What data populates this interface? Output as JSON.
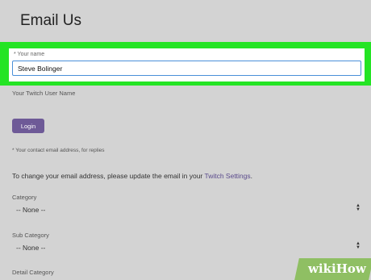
{
  "page": {
    "title": "Email Us"
  },
  "form": {
    "name_label": "* Your name",
    "name_value": "Steve Bolinger",
    "twitch_label": "Your Twitch User Name",
    "login_label": "Login",
    "contact_note": "* Your contact email address, for replies",
    "change_note_prefix": "To change your email address, please update the email in your ",
    "change_note_link": "Twitch Settings",
    "change_note_suffix": ".",
    "category_label": "Category",
    "category_value": "-- None --",
    "subcategory_label": "Sub Category",
    "subcategory_value": "-- None --",
    "detail_label": "Detail Category"
  },
  "watermark": {
    "text": "wikiHow"
  },
  "colors": {
    "highlight": "#24e424",
    "login_button": "#6e5a97",
    "link": "#5a4a8c",
    "input_border": "#4a90d9"
  }
}
